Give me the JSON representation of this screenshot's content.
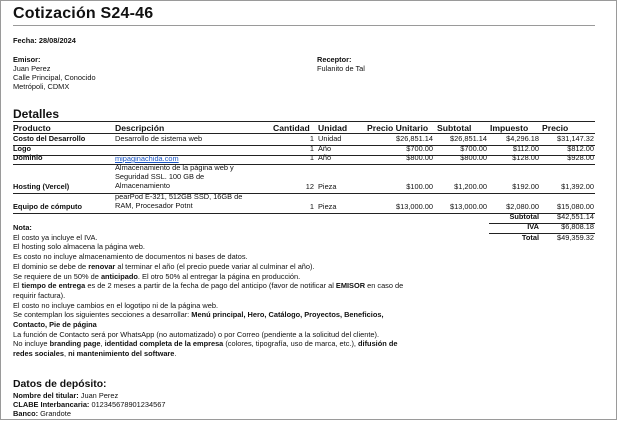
{
  "title": "Cotización S24-46",
  "fecha_label": "Fecha:",
  "fecha_value": "28/08/2024",
  "emisor": {
    "label": "Emisor:",
    "lines": [
      "Juan Perez",
      "Calle Principal, Conocido",
      "Metrópoli, CDMX"
    ]
  },
  "receptor": {
    "label": "Receptor:",
    "lines": [
      "Fulanito de Tal"
    ]
  },
  "detalles_title": "Detalles",
  "table": {
    "headers": [
      "Producto",
      "Descripción",
      "Cantidad",
      "Unidad",
      "Precio Unitario",
      "Subtotal",
      "Impuesto",
      "Precio"
    ],
    "rows": [
      {
        "producto": "Costo del Desarrollo",
        "descripcion": [
          "Desarrollo de sistema web"
        ],
        "cantidad": "1",
        "unidad": "Unidad",
        "precio_unitario": "$26,851.14",
        "subtotal": "$26,851.14",
        "impuesto": "$4,296.18",
        "precio": "$31,147.32"
      },
      {
        "producto": "Logo",
        "descripcion": [
          ""
        ],
        "cantidad": "1",
        "unidad": "Año",
        "precio_unitario": "$700.00",
        "subtotal": "$700.00",
        "impuesto": "$112.00",
        "precio": "$812.00"
      },
      {
        "producto": "Dominio",
        "descripcion": [
          "mipaginachida.com"
        ],
        "cantidad": "1",
        "unidad": "Año",
        "precio_unitario": "$800.00",
        "subtotal": "$800.00",
        "impuesto": "$128.00",
        "precio": "$928.00"
      },
      {
        "producto": "Hosting (Vercel)",
        "descripcion": [
          "Almacenamiento de la página web y",
          "Seguridad SSL. 100 GB de",
          "Almacenamiento"
        ],
        "cantidad": "12",
        "unidad": "Pieza",
        "precio_unitario": "$100.00",
        "subtotal": "$1,200.00",
        "impuesto": "$192.00",
        "precio": "$1,392.00"
      },
      {
        "producto": "Equipo de cómputo",
        "descripcion": [
          "pearPod E-321, 512GB SSD, 16GB de",
          "RAM, Procesador Potnt"
        ],
        "cantidad": "1",
        "unidad": "Pieza",
        "precio_unitario": "$13,000.00",
        "subtotal": "$13,000.00",
        "impuesto": "$2,080.00",
        "precio": "$15,080.00"
      }
    ]
  },
  "totals": [
    {
      "label": "Subtotal",
      "value": "$42,551.14"
    },
    {
      "label": "IVA",
      "value": "$6,808.18"
    },
    {
      "label": "Total",
      "value": "$49,359.32"
    }
  ],
  "nota_label": "Nota:",
  "notes": [
    [
      {
        "t": "El costo ya incluye el IVA."
      }
    ],
    [
      {
        "t": "El hosting solo almacena la página web."
      }
    ],
    [
      {
        "t": "Es costo no incluye almacenamiento de documentos ni bases de datos."
      }
    ],
    [
      {
        "t": "El dominio se debe de "
      },
      {
        "t": "renovar",
        "b": true
      },
      {
        "t": " al terminar el año (el precio puede variar al culminar el año)."
      }
    ],
    [
      {
        "t": "Se requiere de un 50% de "
      },
      {
        "t": "anticipado",
        "b": true
      },
      {
        "t": ". El otro 50% al entregar la página en producción."
      }
    ],
    [
      {
        "t": "El "
      },
      {
        "t": "tiempo de entrega",
        "b": true
      },
      {
        "t": " es de 2 meses a partir de la fecha de pago del anticipo (favor de notificar al "
      },
      {
        "t": "EMISOR",
        "b": true
      },
      {
        "t": " en caso de requirir factura)."
      }
    ],
    [
      {
        "t": "El costo no incluye cambios en el logotipo ni de la página web."
      }
    ],
    [
      {
        "t": "Se contemplan los siguientes secciones a desarrollar: "
      },
      {
        "t": "Menú principal, Hero, Catálogo, Proyectos, Beneficios, Contacto, Pie de página",
        "b": true
      }
    ],
    [
      {
        "t": "La función de Contacto será por WhatsApp (no automatizado) o por Correo (pendiente a la solicitud del cliente)."
      }
    ],
    [
      {
        "t": "No incluye "
      },
      {
        "t": "branding page",
        "b": true
      },
      {
        "t": ", "
      },
      {
        "t": "identidad completa de la empresa",
        "b": true
      },
      {
        "t": " (colores, tipografía, uso de marca, etc.), "
      },
      {
        "t": "difusión de redes sociales",
        "b": true
      },
      {
        "t": ", "
      },
      {
        "t": "ni mantenimiento del software",
        "b": true
      },
      {
        "t": "."
      }
    ]
  ],
  "deposito": {
    "title": "Datos de depósito:",
    "items": [
      {
        "label": "Nombre del titular:",
        "value": "Juan Perez"
      },
      {
        "label": "CLABE Interbancaria:",
        "value": "012345678901234567"
      },
      {
        "label": "Banco:",
        "value": "Grandote"
      }
    ]
  }
}
